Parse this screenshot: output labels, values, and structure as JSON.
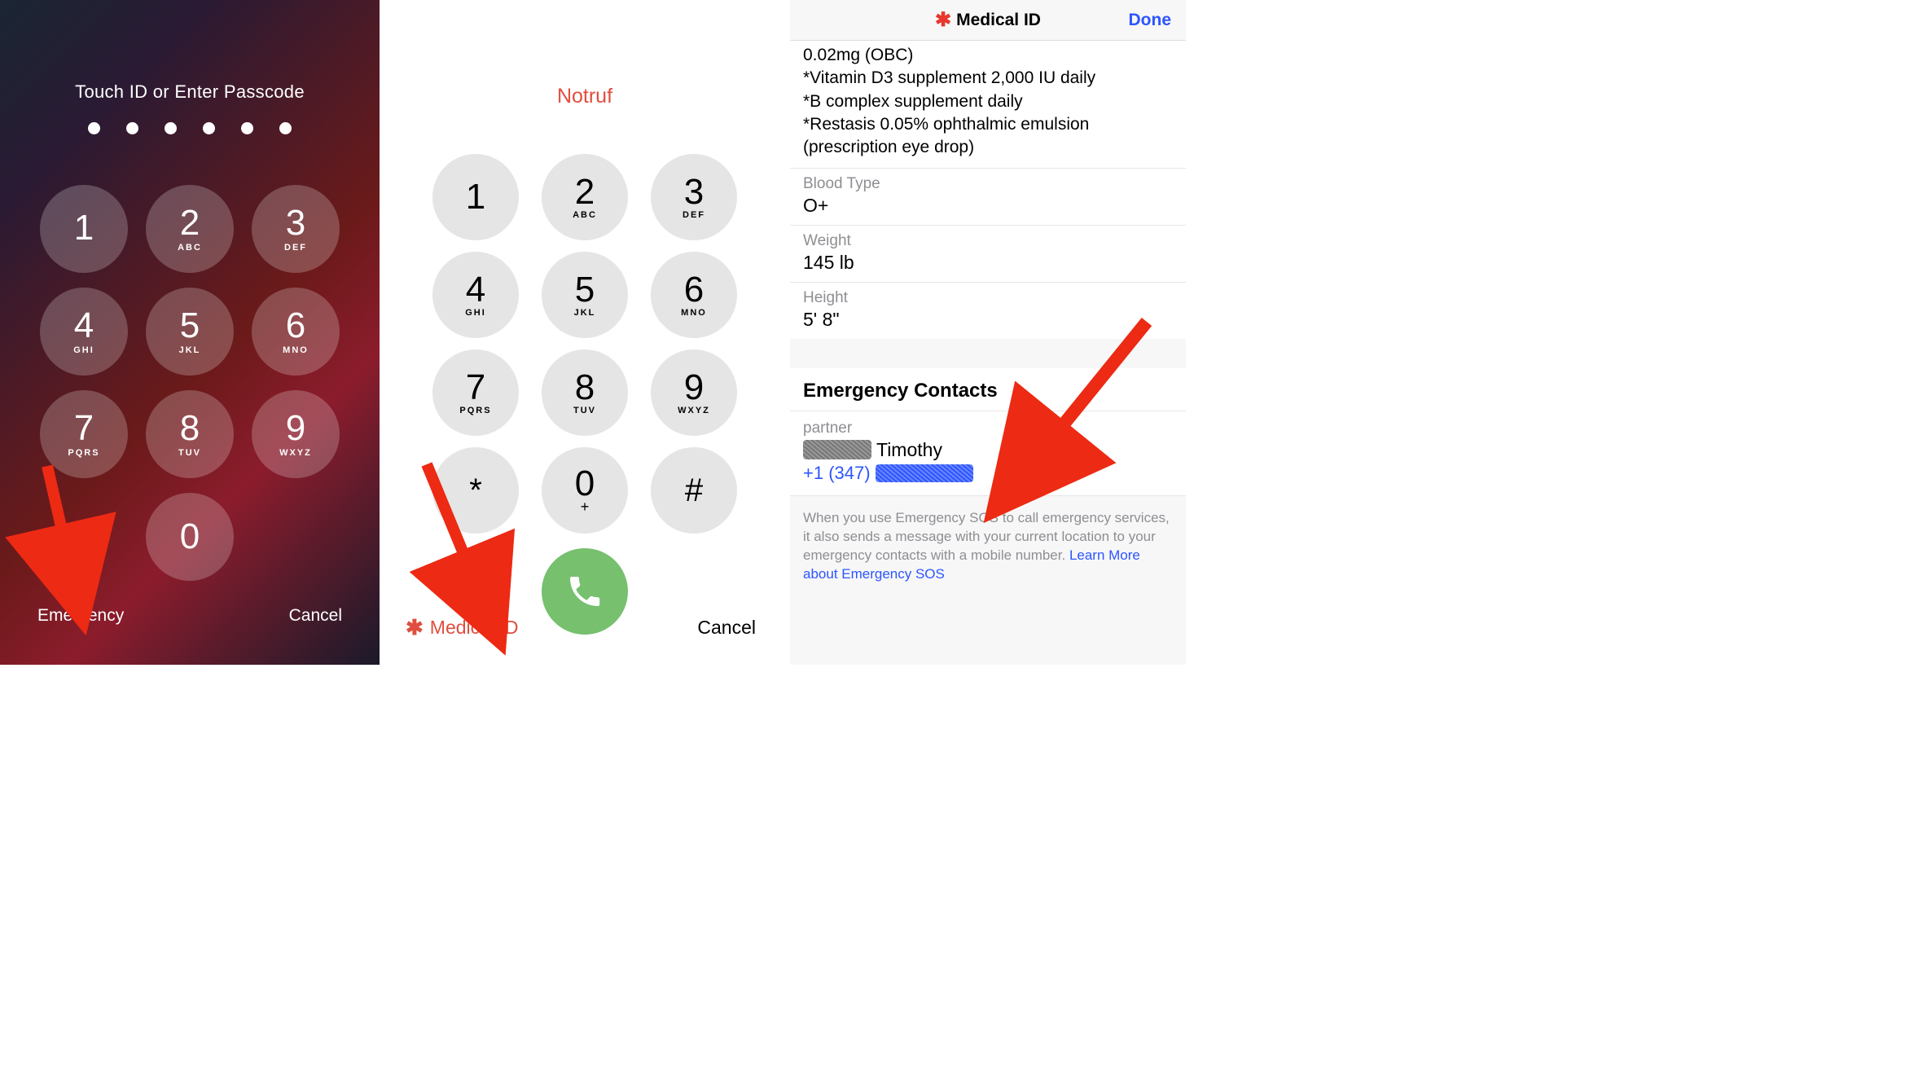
{
  "lock": {
    "prompt": "Touch ID or Enter Passcode",
    "keys": [
      {
        "num": "1",
        "sub": ""
      },
      {
        "num": "2",
        "sub": "ABC"
      },
      {
        "num": "3",
        "sub": "DEF"
      },
      {
        "num": "4",
        "sub": "GHI"
      },
      {
        "num": "5",
        "sub": "JKL"
      },
      {
        "num": "6",
        "sub": "MNO"
      },
      {
        "num": "7",
        "sub": "PQRS"
      },
      {
        "num": "8",
        "sub": "TUV"
      },
      {
        "num": "9",
        "sub": "WXYZ"
      },
      {
        "num": "0",
        "sub": ""
      }
    ],
    "emergency": "Emergency",
    "cancel": "Cancel"
  },
  "call": {
    "title": "Notruf",
    "keys": [
      {
        "num": "1",
        "sub": ""
      },
      {
        "num": "2",
        "sub": "ABC"
      },
      {
        "num": "3",
        "sub": "DEF"
      },
      {
        "num": "4",
        "sub": "GHI"
      },
      {
        "num": "5",
        "sub": "JKL"
      },
      {
        "num": "6",
        "sub": "MNO"
      },
      {
        "num": "7",
        "sub": "PQRS"
      },
      {
        "num": "8",
        "sub": "TUV"
      },
      {
        "num": "9",
        "sub": "WXYZ"
      },
      {
        "num": "*",
        "sub": ""
      },
      {
        "num": "0",
        "sub": "+"
      },
      {
        "num": "#",
        "sub": ""
      }
    ],
    "medical_id": "Medical ID",
    "cancel": "Cancel"
  },
  "med": {
    "header": "Medical ID",
    "done": "Done",
    "meds_cut": "0.02mg (OBC)",
    "meds_lines": [
      "*Vitamin D3 supplement 2,000 IU daily",
      "*B complex supplement daily",
      "*Restasis 0.05% ophthalmic emulsion (prescription eye drop)"
    ],
    "blood_label": "Blood Type",
    "blood_value": "O+",
    "weight_label": "Weight",
    "weight_value": "145 lb",
    "height_label": "Height",
    "height_value": "5' 8\"",
    "ec_header": "Emergency Contacts",
    "contact_rel": "partner",
    "contact_name_suffix": "Timothy",
    "contact_phone_prefix": "+1 (347)",
    "footer_text": "When you use Emergency SOS to call emergency services, it also sends a message with your current location to your emergency contacts with a mobile number. ",
    "footer_link": "Learn More about Emergency SOS"
  }
}
